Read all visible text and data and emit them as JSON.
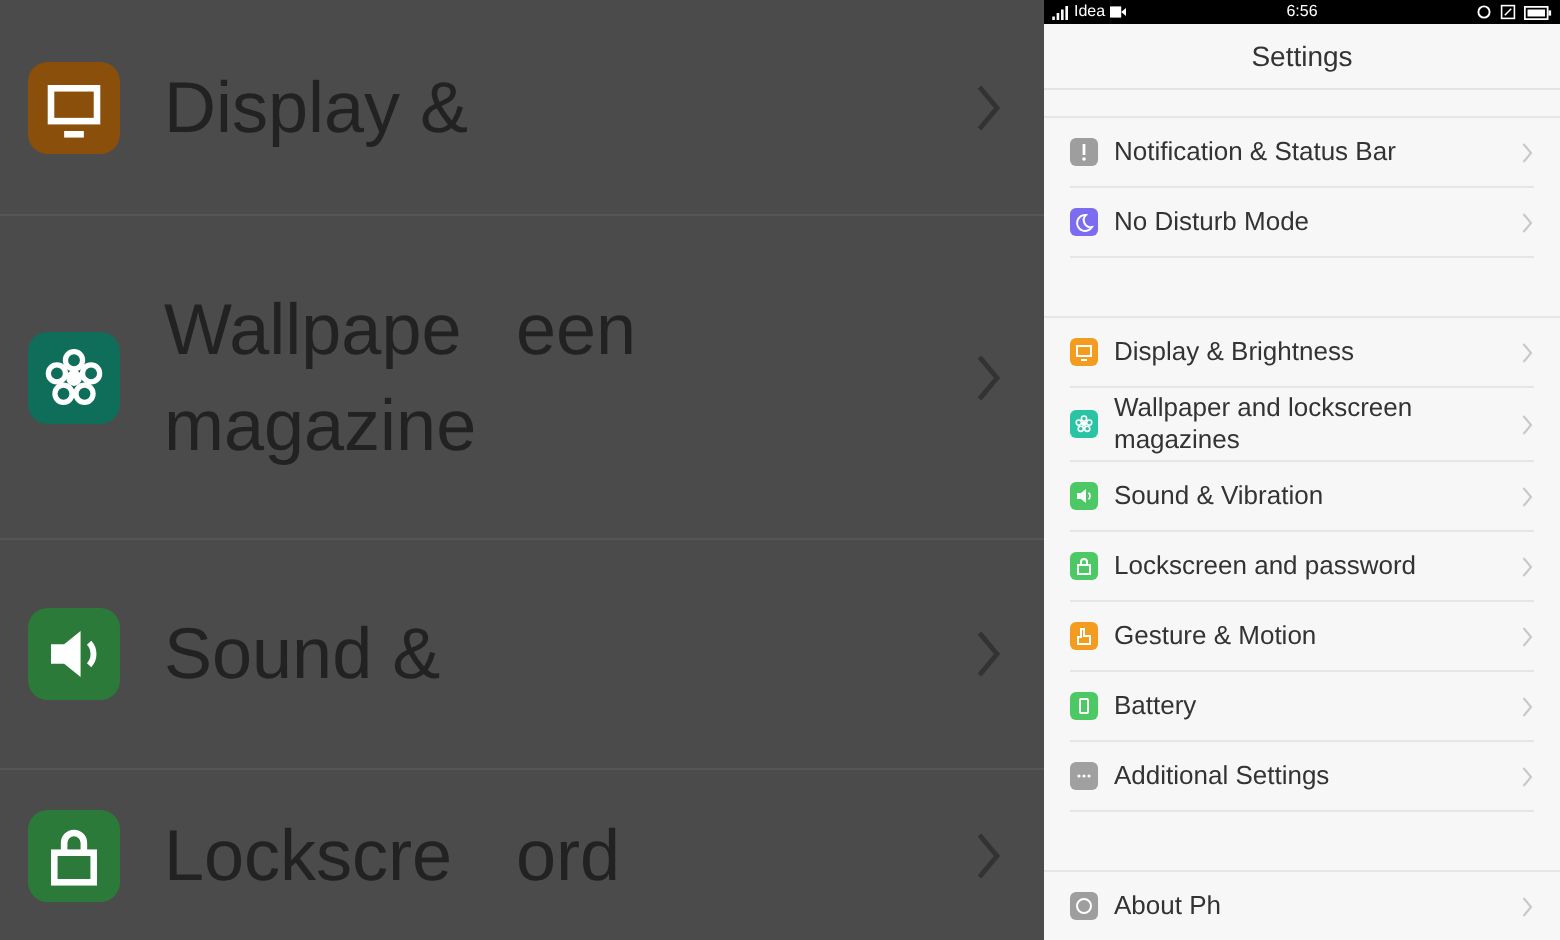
{
  "backdrop": {
    "left_rows": [
      {
        "lines": [
          "Display &"
        ],
        "kind": "monitor",
        "color": "#8a4f0a"
      },
      {
        "lines": [
          "Wallpape",
          "magazine"
        ],
        "kind": "flower",
        "color": "#0f6e5a"
      },
      {
        "lines": [
          "Sound &"
        ],
        "kind": "speaker",
        "color": "#2c7a3a"
      },
      {
        "lines": [
          "Lockscre"
        ],
        "kind": "lock",
        "color": "#2c7a3a"
      }
    ],
    "right_rows": [
      {
        "lines": []
      },
      {
        "lines": [
          "een"
        ]
      },
      {
        "lines": []
      },
      {
        "lines": [
          "ord"
        ]
      }
    ]
  },
  "status_bar": {
    "carrier": "Idea",
    "time": "6:56"
  },
  "header": {
    "title": "Settings"
  },
  "groups": [
    [
      {
        "label": "Notification & Status Bar",
        "kind": "alert",
        "color": "#9e9e9e"
      },
      {
        "label": "No Disturb Mode",
        "kind": "moon",
        "color": "#7b6cf0"
      }
    ],
    [
      {
        "label": "Display & Brightness",
        "kind": "monitor",
        "color": "#f39c1f"
      },
      {
        "label": "Wallpaper and lockscreen magazines",
        "kind": "flower",
        "color": "#2ac4a4"
      },
      {
        "label": "Sound & Vibration",
        "kind": "speaker",
        "color": "#4cc964"
      },
      {
        "label": "Lockscreen and password",
        "kind": "lock",
        "color": "#4cc964"
      },
      {
        "label": "Gesture & Motion",
        "kind": "hand",
        "color": "#f39c1f"
      },
      {
        "label": "Battery",
        "kind": "battery",
        "color": "#4cc964"
      },
      {
        "label": "Additional Settings",
        "kind": "dots",
        "color": "#a0a0a0"
      }
    ],
    [
      {
        "label": "About Ph",
        "kind": "info",
        "color": "#9e9e9e"
      }
    ]
  ]
}
